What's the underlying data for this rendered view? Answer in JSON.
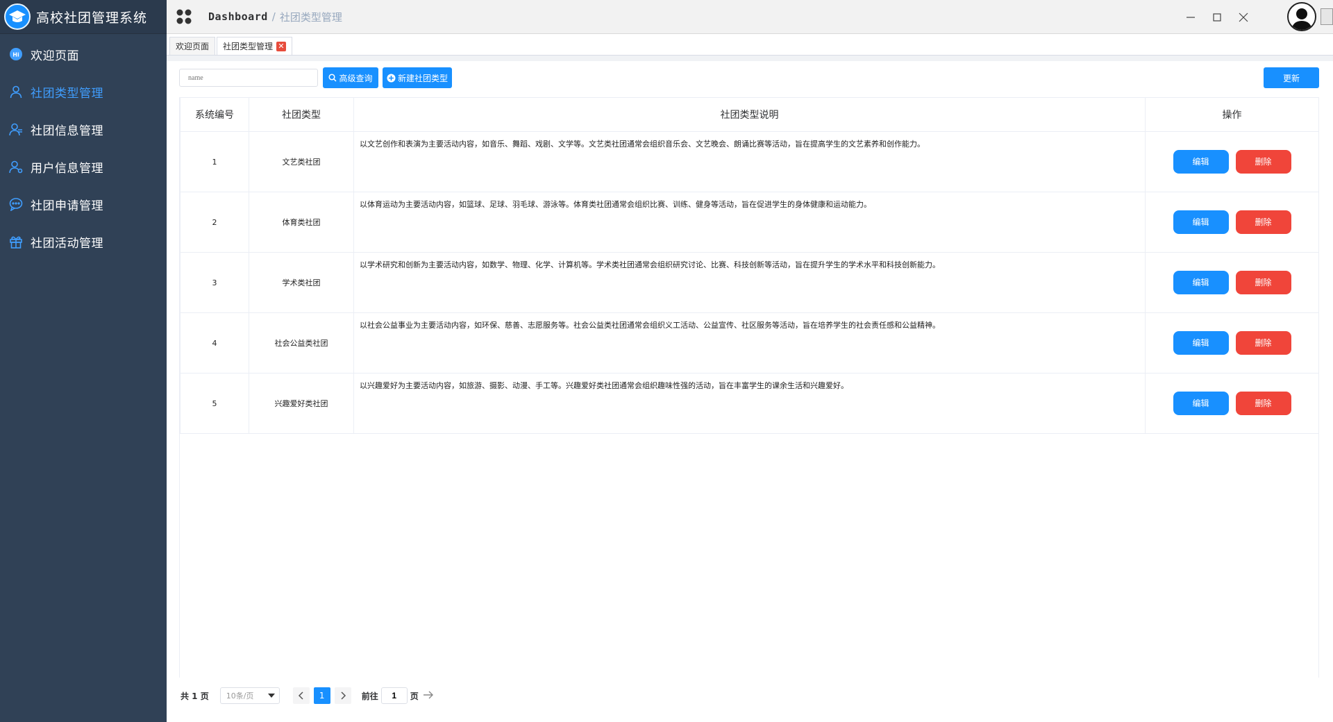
{
  "app": {
    "title": "高校社团管理系统"
  },
  "sidebar": {
    "items": [
      {
        "label": "欢迎页面",
        "icon": "hi-badge-icon",
        "active": false
      },
      {
        "label": "社团类型管理",
        "icon": "user-icon",
        "active": true
      },
      {
        "label": "社团信息管理",
        "icon": "users-icon",
        "active": false
      },
      {
        "label": "用户信息管理",
        "icon": "user-setting-icon",
        "active": false
      },
      {
        "label": "社团申请管理",
        "icon": "chat-icon",
        "active": false
      },
      {
        "label": "社团活动管理",
        "icon": "gift-icon",
        "active": false
      }
    ]
  },
  "header": {
    "breadcrumb_home": "Dashboard",
    "breadcrumb_sep": "/",
    "breadcrumb_current": "社团类型管理"
  },
  "tabs": [
    {
      "label": "欢迎页面",
      "active": false
    },
    {
      "label": "社团类型管理",
      "active": true,
      "close": "✕"
    }
  ],
  "toolbar": {
    "search_placeholder": "name",
    "search_label": "高级查询",
    "new_label": "新建社团类型",
    "refresh_label": "更新"
  },
  "table": {
    "headers": [
      "系统编号",
      "社团类型",
      "社团类型说明",
      "操作"
    ],
    "rows": [
      {
        "id": "1",
        "type": "文艺类社团",
        "desc": "以文艺创作和表演为主要活动内容，如音乐、舞蹈、戏剧、文学等。文艺类社团通常会组织音乐会、文艺晚会、朗诵比赛等活动，旨在提高学生的文艺素养和创作能力。"
      },
      {
        "id": "2",
        "type": "体育类社团",
        "desc": "以体育运动为主要活动内容，如篮球、足球、羽毛球、游泳等。体育类社团通常会组织比赛、训练、健身等活动，旨在促进学生的身体健康和运动能力。"
      },
      {
        "id": "3",
        "type": "学术类社团",
        "desc": "以学术研究和创新为主要活动内容，如数学、物理、化学、计算机等。学术类社团通常会组织研究讨论、比赛、科技创新等活动，旨在提升学生的学术水平和科技创新能力。"
      },
      {
        "id": "4",
        "type": "社会公益类社团",
        "desc": "以社会公益事业为主要活动内容，如环保、慈善、志愿服务等。社会公益类社团通常会组织义工活动、公益宣传、社区服务等活动，旨在培养学生的社会责任感和公益精神。"
      },
      {
        "id": "5",
        "type": "兴趣爱好类社团",
        "desc": "以兴趣爱好为主要活动内容，如旅游、摄影、动漫、手工等。兴趣爱好类社团通常会组织趣味性强的活动，旨在丰富学生的课余生活和兴趣爱好。"
      }
    ],
    "edit_label": "编辑",
    "delete_label": "删除"
  },
  "pagination": {
    "total_text": "共 1 页",
    "page_size": "10条/页",
    "current_page": "1",
    "goto_label": "前往",
    "goto_value": "1",
    "page_suffix": "页"
  },
  "colors": {
    "sidebar_bg": "#304156",
    "accent": "#1890ff",
    "danger": "#f0453a",
    "active_menu": "#409eff"
  }
}
